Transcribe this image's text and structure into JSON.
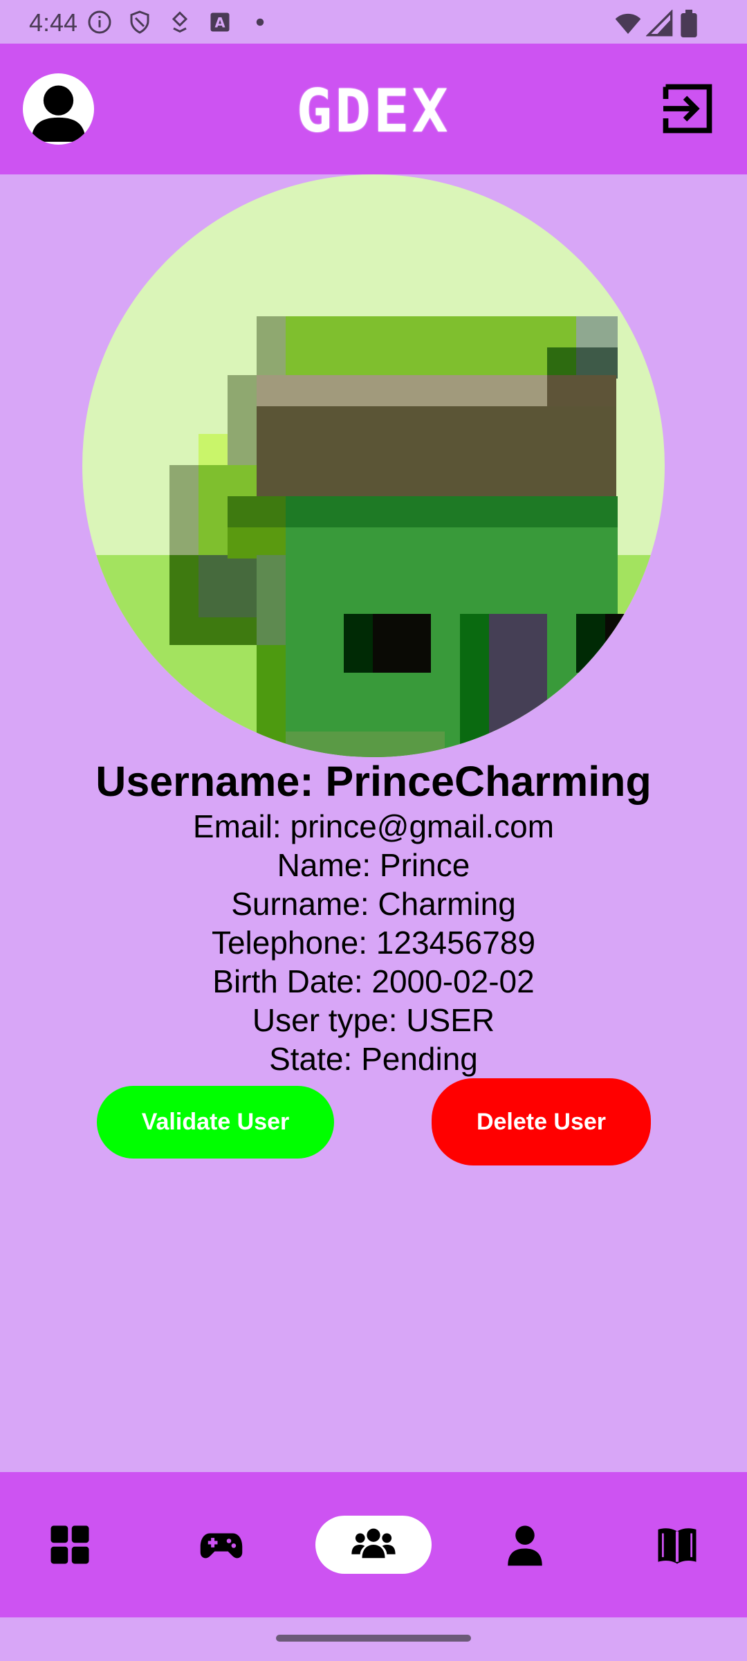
{
  "status_bar": {
    "time": "4:44",
    "icons_left": [
      "info-icon",
      "shield-icon",
      "download-icon",
      "text-icon",
      "dot-icon"
    ],
    "icons_right": [
      "wifi-icon",
      "signal-icon",
      "battery-icon"
    ]
  },
  "app_bar": {
    "title": "GDEX",
    "avatar_icon": "person-icon",
    "logout_icon": "logout-icon"
  },
  "profile": {
    "username": "Username: PrinceCharming",
    "email": "Email: prince@gmail.com",
    "name": "Name: Prince",
    "surname": "Surname: Charming",
    "telephone": "Telephone: 123456789",
    "birth_date": "Birth Date: 2000-02-02",
    "user_type": "User type: USER",
    "state": "State: Pending"
  },
  "actions": {
    "validate_label": "Validate User",
    "delete_label": "Delete User",
    "validate_color": "#00ff00",
    "delete_color": "#ff0000"
  },
  "bottom_nav": {
    "items": [
      {
        "icon": "dashboard-icon",
        "active": false
      },
      {
        "icon": "gamepad-icon",
        "active": false
      },
      {
        "icon": "users-icon",
        "active": true
      },
      {
        "icon": "person-icon",
        "active": false
      },
      {
        "icon": "book-icon",
        "active": false
      }
    ]
  },
  "colors": {
    "background": "#d8a6f7",
    "bar": "#cd53f2"
  }
}
